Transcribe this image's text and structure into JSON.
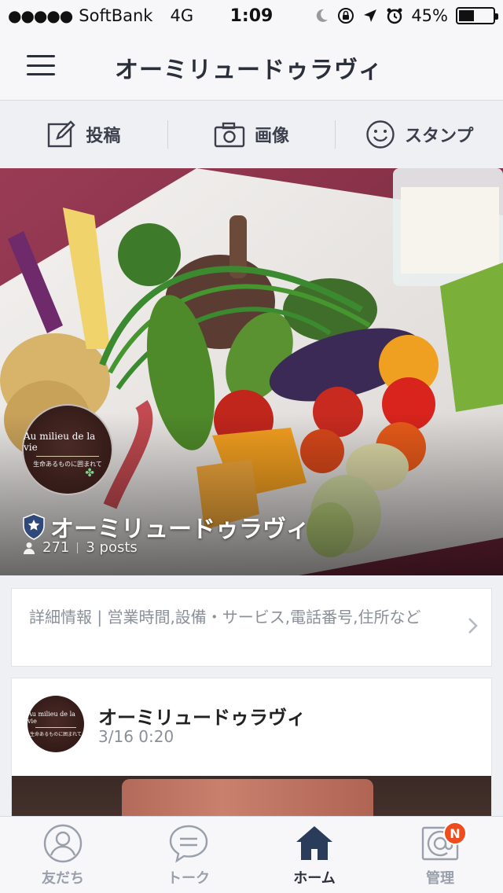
{
  "status_bar": {
    "signal": "●●●●●",
    "carrier": "SoftBank",
    "network": "4G",
    "time": "1:09",
    "battery_percent": "45%",
    "battery_level": 0.45
  },
  "navbar": {
    "title": "オーミリュードゥラヴィ"
  },
  "actions": [
    {
      "label": "投稿",
      "icon": "compose-icon"
    },
    {
      "label": "画像",
      "icon": "camera-icon"
    },
    {
      "label": "スタンプ",
      "icon": "smiley-icon"
    }
  ],
  "cover": {
    "avatar_name": "Au milieu de la vie",
    "avatar_sub": "生命あるものに囲まれて",
    "name": "オーミリュードゥラヴィ",
    "followers": "271",
    "posts": "3 posts"
  },
  "info": {
    "text": "詳細情報 | 営業時間,設備・サービス,電話番号,住所など"
  },
  "post": {
    "author": "オーミリュードゥラヴィ",
    "date": "3/16 0:20",
    "avatar_name": "Au milieu de la vie",
    "avatar_sub": "生命あるものに囲まれて"
  },
  "tabs": [
    {
      "label": "友だち",
      "icon": "person-icon",
      "active": false
    },
    {
      "label": "トーク",
      "icon": "chat-bubble-icon",
      "active": false
    },
    {
      "label": "ホーム",
      "icon": "home-icon",
      "active": true
    },
    {
      "label": "管理",
      "icon": "at-icon",
      "active": false,
      "badge": "N"
    }
  ],
  "colors": {
    "accent": "#2b2f3a",
    "badge": "#ef4b1c",
    "inactive": "#9aa0ab"
  }
}
